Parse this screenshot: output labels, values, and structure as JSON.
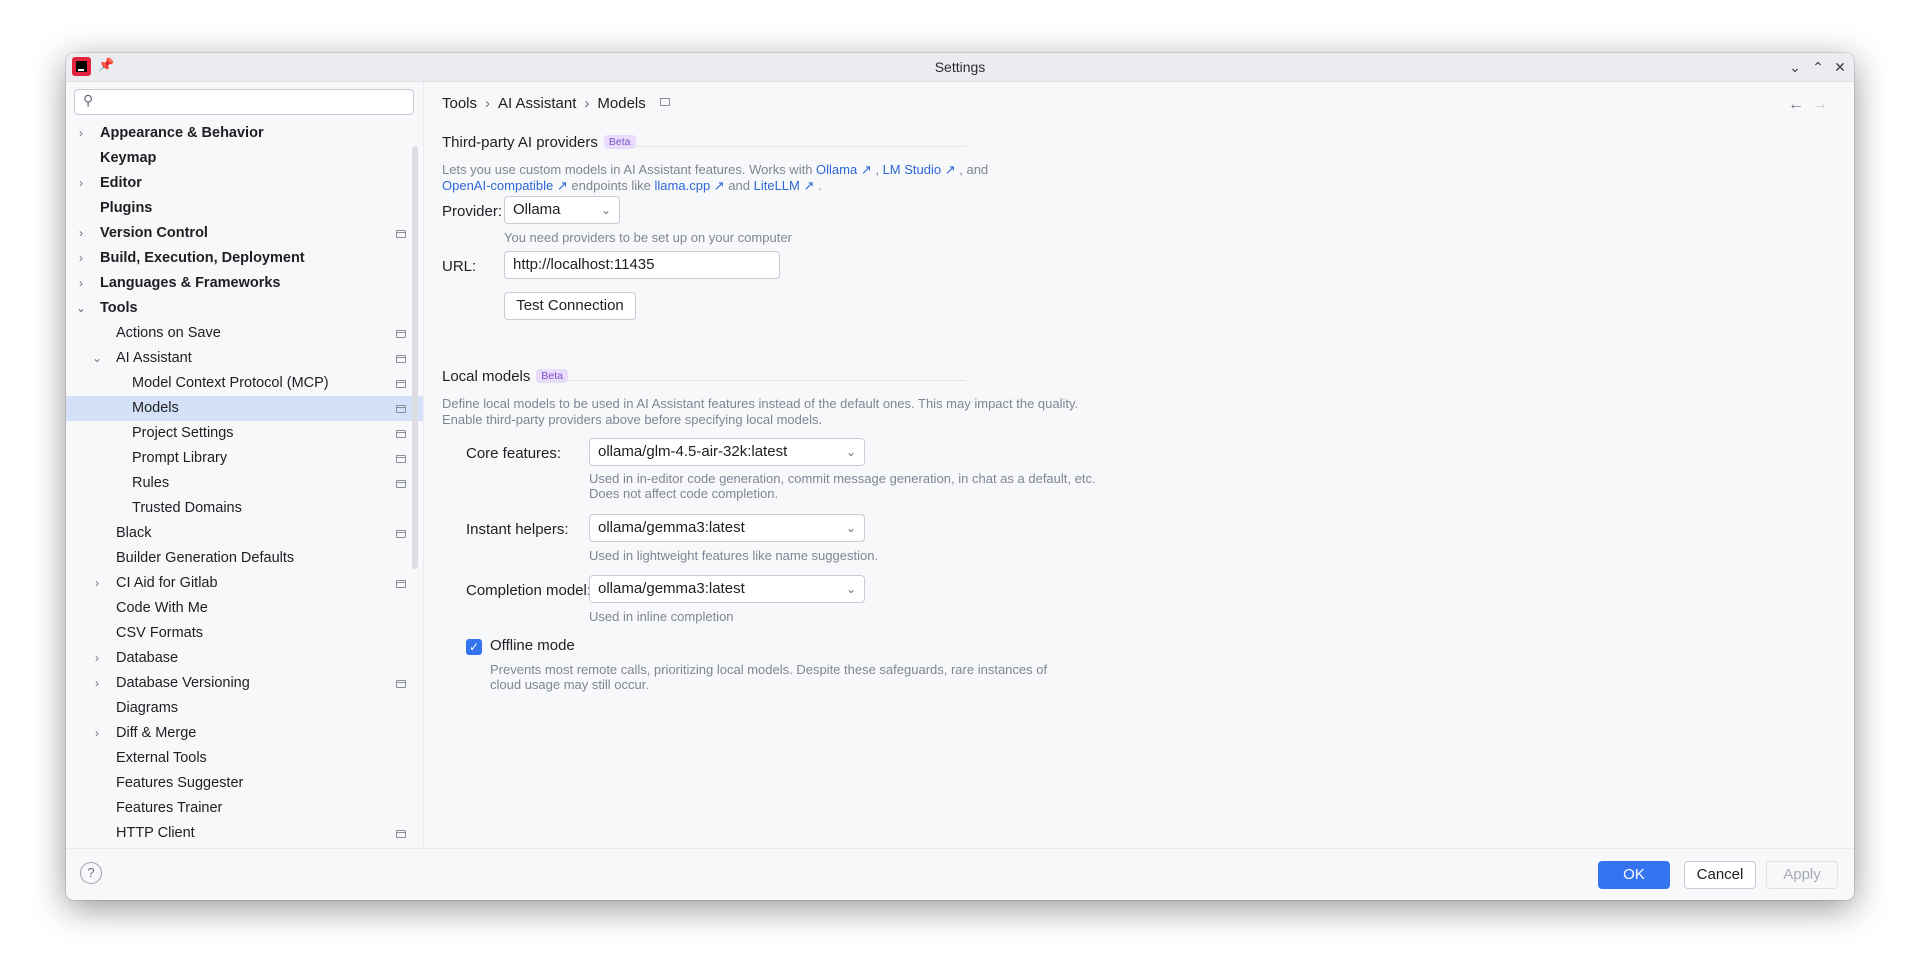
{
  "window": {
    "title": "Settings"
  },
  "sidebar": {
    "search_placeholder": "",
    "items": [
      {
        "label": "Appearance & Behavior",
        "bold": true,
        "arrow": "›",
        "level": 0,
        "proj": false
      },
      {
        "label": "Keymap",
        "bold": true,
        "arrow": "",
        "level": 0,
        "proj": false
      },
      {
        "label": "Editor",
        "bold": true,
        "arrow": "›",
        "level": 0,
        "proj": false
      },
      {
        "label": "Plugins",
        "bold": true,
        "arrow": "",
        "level": 0,
        "proj": false
      },
      {
        "label": "Version Control",
        "bold": true,
        "arrow": "›",
        "level": 0,
        "proj": true
      },
      {
        "label": "Build, Execution, Deployment",
        "bold": true,
        "arrow": "›",
        "level": 0,
        "proj": false
      },
      {
        "label": "Languages & Frameworks",
        "bold": true,
        "arrow": "›",
        "level": 0,
        "proj": false
      },
      {
        "label": "Tools",
        "bold": true,
        "arrow": "⌄",
        "level": 0,
        "proj": false
      },
      {
        "label": "Actions on Save",
        "bold": false,
        "arrow": "",
        "level": 1,
        "proj": true
      },
      {
        "label": "AI Assistant",
        "bold": false,
        "arrow": "⌄",
        "level": 1,
        "proj": true
      },
      {
        "label": "Model Context Protocol (MCP)",
        "bold": false,
        "arrow": "",
        "level": 2,
        "proj": true
      },
      {
        "label": "Models",
        "bold": false,
        "arrow": "",
        "level": 2,
        "proj": true,
        "selected": true
      },
      {
        "label": "Project Settings",
        "bold": false,
        "arrow": "",
        "level": 2,
        "proj": true
      },
      {
        "label": "Prompt Library",
        "bold": false,
        "arrow": "",
        "level": 2,
        "proj": true
      },
      {
        "label": "Rules",
        "bold": false,
        "arrow": "",
        "level": 2,
        "proj": true
      },
      {
        "label": "Trusted Domains",
        "bold": false,
        "arrow": "",
        "level": 2,
        "proj": false
      },
      {
        "label": "Black",
        "bold": false,
        "arrow": "",
        "level": 1,
        "proj": true
      },
      {
        "label": "Builder Generation Defaults",
        "bold": false,
        "arrow": "",
        "level": 1,
        "proj": false
      },
      {
        "label": "CI Aid for Gitlab",
        "bold": false,
        "arrow": "›",
        "level": 1,
        "proj": true
      },
      {
        "label": "Code With Me",
        "bold": false,
        "arrow": "",
        "level": 1,
        "proj": false
      },
      {
        "label": "CSV Formats",
        "bold": false,
        "arrow": "",
        "level": 1,
        "proj": false
      },
      {
        "label": "Database",
        "bold": false,
        "arrow": "›",
        "level": 1,
        "proj": false
      },
      {
        "label": "Database Versioning",
        "bold": false,
        "arrow": "›",
        "level": 1,
        "proj": true
      },
      {
        "label": "Diagrams",
        "bold": false,
        "arrow": "",
        "level": 1,
        "proj": false
      },
      {
        "label": "Diff & Merge",
        "bold": false,
        "arrow": "›",
        "level": 1,
        "proj": false
      },
      {
        "label": "External Tools",
        "bold": false,
        "arrow": "",
        "level": 1,
        "proj": false
      },
      {
        "label": "Features Suggester",
        "bold": false,
        "arrow": "",
        "level": 1,
        "proj": false
      },
      {
        "label": "Features Trainer",
        "bold": false,
        "arrow": "",
        "level": 1,
        "proj": false
      },
      {
        "label": "HTTP Client",
        "bold": false,
        "arrow": "",
        "level": 1,
        "proj": true
      }
    ]
  },
  "breadcrumb": {
    "items": [
      "Tools",
      "AI Assistant",
      "Models"
    ]
  },
  "third_party": {
    "title": "Third-party AI providers",
    "badge": "Beta",
    "desc_1a": "Lets you use custom models in AI Assistant features. Works with ",
    "link_ollama": "Ollama ↗",
    "desc_1b": " , ",
    "link_lmstudio": "LM Studio ↗",
    "desc_1c": " , and",
    "link_openai": "OpenAI-compatible ↗",
    "desc_2a": "  endpoints like ",
    "link_llamacpp": "llama.cpp ↗",
    "desc_2b": "  and ",
    "link_litellm": "LiteLLM ↗",
    "desc_2c": " .",
    "provider_label": "Provider:",
    "provider_value": "Ollama",
    "provider_hint": "You need providers to be set up on your computer",
    "url_label": "URL:",
    "url_value": "http://localhost:11435",
    "test_button": "Test Connection"
  },
  "local_models": {
    "title": "Local models",
    "badge": "Beta",
    "desc_1": "Define local models to be used in AI Assistant features instead of the default ones. This may impact the quality.",
    "desc_2": "Enable third-party providers above before specifying local models.",
    "core_label": "Core features:",
    "core_value": "ollama/glm-4.5-air-32k:latest",
    "core_hint_1": "Used in in-editor code generation, commit message generation, in chat as a default, etc.",
    "core_hint_2": "Does not affect code completion.",
    "instant_label": "Instant helpers:",
    "instant_value": "ollama/gemma3:latest",
    "instant_hint": "Used in lightweight features like name suggestion.",
    "completion_label": "Completion model:",
    "completion_value": "ollama/gemma3:latest",
    "completion_hint": "Used in inline completion",
    "offline_label": "Offline mode",
    "offline_checked": true,
    "offline_hint_1": "Prevents most remote calls, prioritizing local models. Despite these safeguards, rare instances of",
    "offline_hint_2": "cloud usage may still occur."
  },
  "footer": {
    "help": "?",
    "ok": "OK",
    "cancel": "Cancel",
    "apply": "Apply"
  }
}
